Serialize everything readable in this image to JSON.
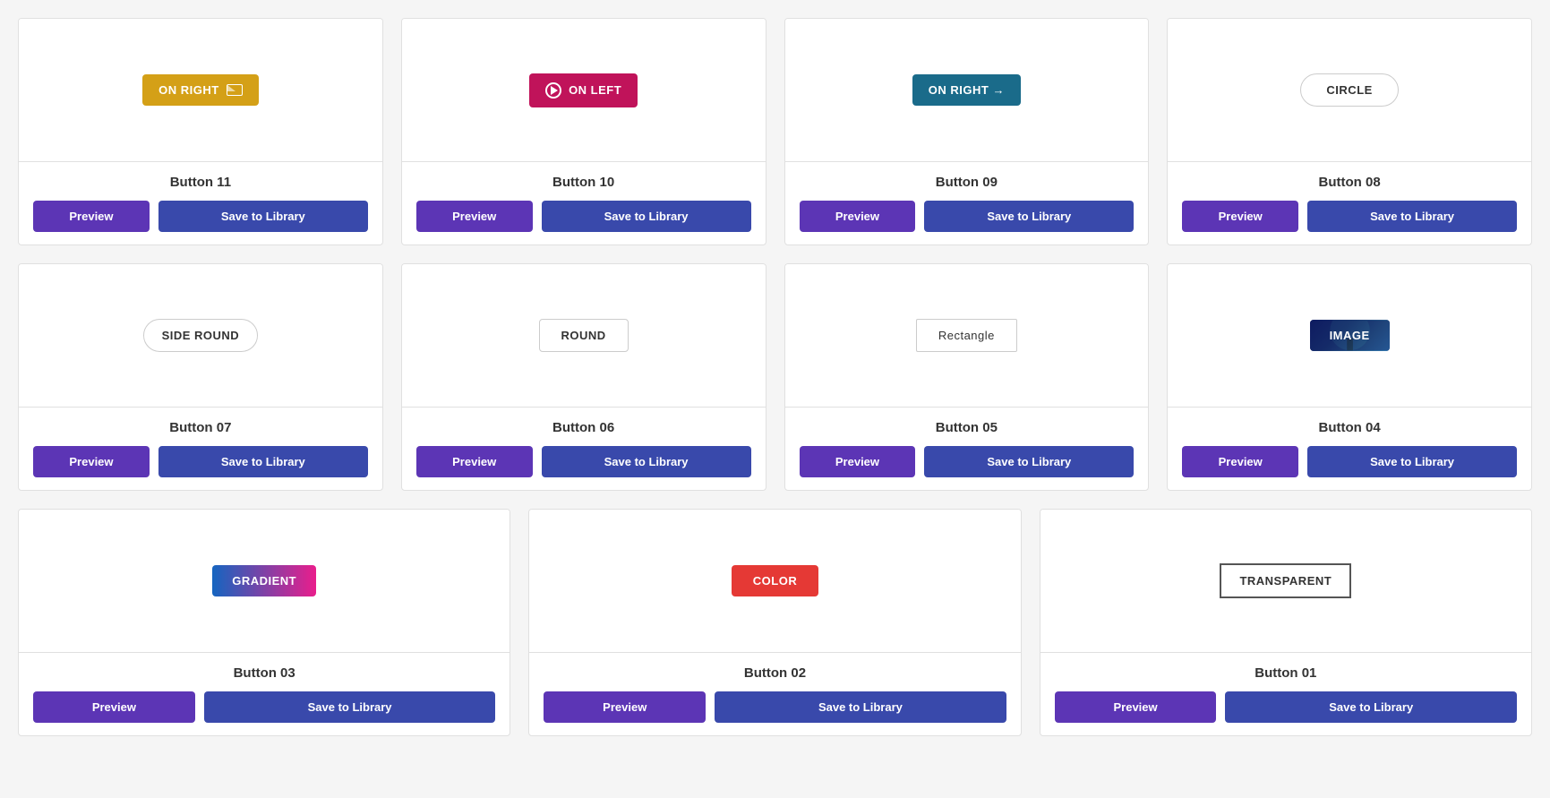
{
  "cards": [
    {
      "id": "btn11",
      "title": "Button 11",
      "type": "on-right",
      "previewLabel": "ON RIGHT",
      "previewIcon": "envelope"
    },
    {
      "id": "btn10",
      "title": "Button 10",
      "type": "on-left",
      "previewLabel": "ON LEFT",
      "previewIcon": "play"
    },
    {
      "id": "btn09",
      "title": "Button 09",
      "type": "on-right-arrow",
      "previewLabel": "ON RIGHT →"
    },
    {
      "id": "btn08",
      "title": "Button 08",
      "type": "circle",
      "previewLabel": "CIRCLE"
    },
    {
      "id": "btn07",
      "title": "Button 07",
      "type": "side-round",
      "previewLabel": "SIDE ROUND"
    },
    {
      "id": "btn06",
      "title": "Button 06",
      "type": "round",
      "previewLabel": "ROUND"
    },
    {
      "id": "btn05",
      "title": "Button 05",
      "type": "rectangle",
      "previewLabel": "Rectangle"
    },
    {
      "id": "btn04",
      "title": "Button 04",
      "type": "image",
      "previewLabel": "IMAGE"
    },
    {
      "id": "btn03",
      "title": "Button 03",
      "type": "gradient",
      "previewLabel": "GRADIENT"
    },
    {
      "id": "btn02",
      "title": "Button 02",
      "type": "color",
      "previewLabel": "COLOR"
    },
    {
      "id": "btn01",
      "title": "Button 01",
      "type": "transparent",
      "previewLabel": "TRANSPARENT"
    }
  ],
  "actions": {
    "preview": "Preview",
    "save": "Save to Library"
  }
}
